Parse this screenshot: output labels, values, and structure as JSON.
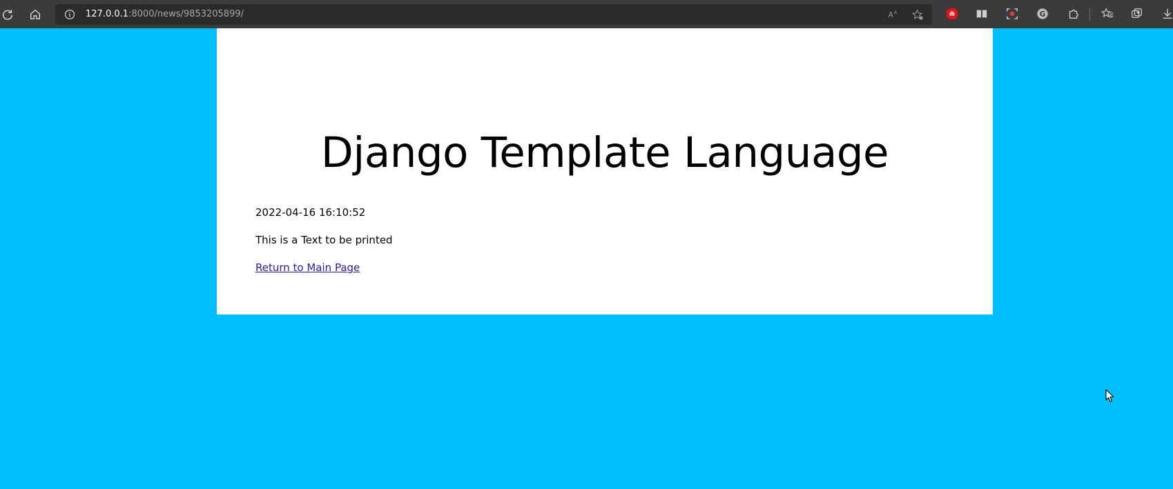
{
  "browser": {
    "url_host": "127.0.0.1",
    "url_path": ":8000/news/9853205899/",
    "icons": {
      "reload": "reload-icon",
      "home": "home-icon",
      "site_info": "info-icon",
      "read_aloud": "read-aloud-icon",
      "favorite": "add-favorite-icon",
      "extensions": [
        "adblock-extension-icon",
        "reader-extension-icon",
        "screen-capture-extension-icon",
        "grammarly-extension-icon",
        "extensions-puzzle-icon"
      ],
      "favorites": "favorites-icon",
      "collections": "collections-icon",
      "downloads": "download-icon"
    }
  },
  "page": {
    "background_color": "#00bfff",
    "title": "Django Template Language",
    "timestamp": "2022-04-16 16:10:52",
    "text": "This is a Text to be printed",
    "link_label": "Return to Main Page",
    "link_color": "#2a1a9c"
  }
}
